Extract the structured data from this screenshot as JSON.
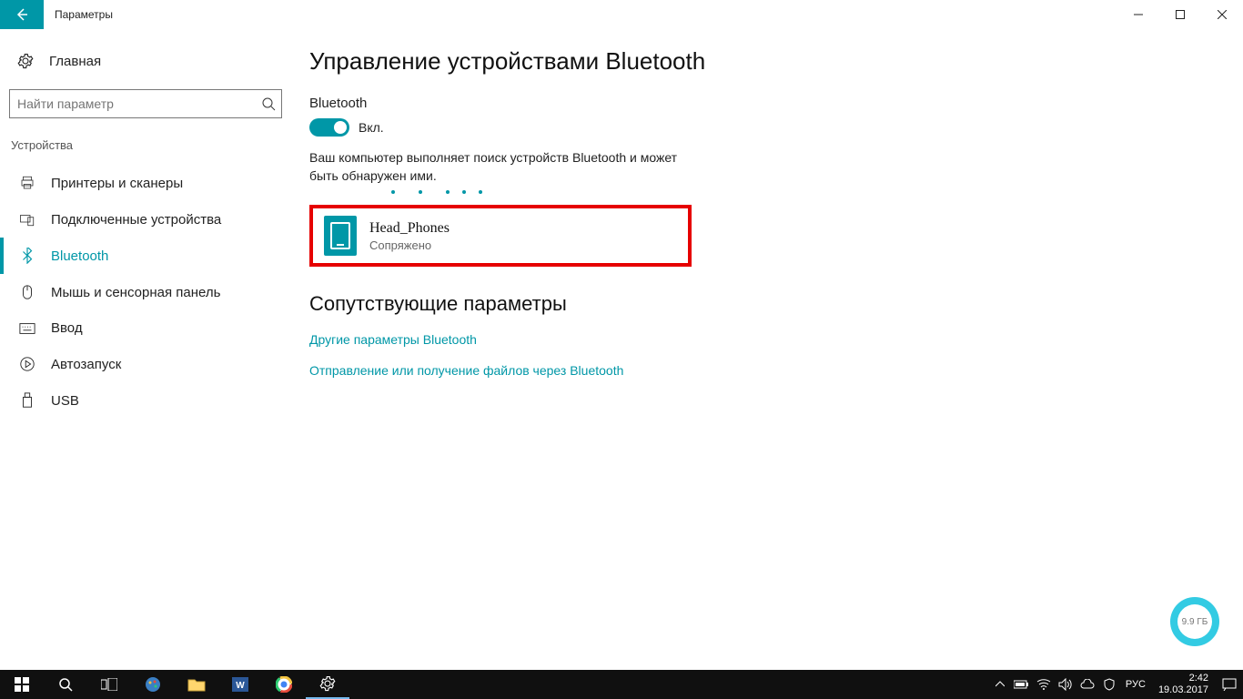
{
  "titlebar": {
    "title": "Параметры"
  },
  "sidebar": {
    "home": "Главная",
    "search_placeholder": "Найти параметр",
    "section": "Устройства",
    "items": [
      {
        "label": "Принтеры и сканеры",
        "icon": "printer-icon"
      },
      {
        "label": "Подключенные устройства",
        "icon": "connected-devices-icon"
      },
      {
        "label": "Bluetooth",
        "icon": "bluetooth-icon",
        "active": true
      },
      {
        "label": "Мышь и сенсорная панель",
        "icon": "mouse-icon"
      },
      {
        "label": "Ввод",
        "icon": "keyboard-icon"
      },
      {
        "label": "Автозапуск",
        "icon": "autoplay-icon"
      },
      {
        "label": "USB",
        "icon": "usb-icon"
      }
    ]
  },
  "main": {
    "title": "Управление устройствами Bluetooth",
    "bluetooth_label": "Bluetooth",
    "toggle_state": "Вкл.",
    "description": "Ваш компьютер выполняет поиск устройств Bluetooth и может быть обнаружен ими.",
    "device": {
      "name": "Head_Phones",
      "status": "Сопряжено"
    },
    "related_title": "Сопутствующие параметры",
    "links": [
      "Другие параметры Bluetooth",
      "Отправление или получение файлов через Bluetooth"
    ]
  },
  "overlay": {
    "text": "9.9 ГБ"
  },
  "taskbar": {
    "lang": "РУС",
    "time": "2:42",
    "date": "19.03.2017"
  }
}
